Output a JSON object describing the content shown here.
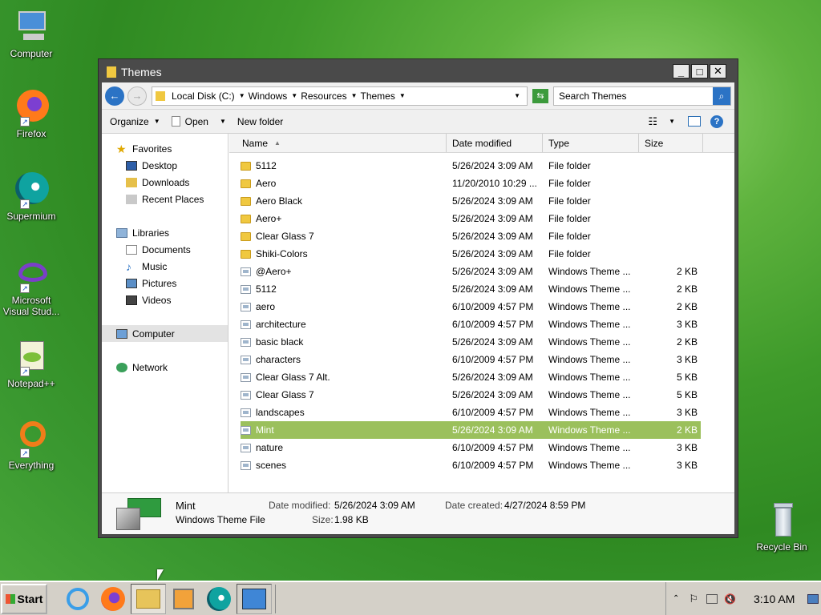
{
  "desktop": {
    "icons": [
      {
        "label": "Computer"
      },
      {
        "label": "Firefox"
      },
      {
        "label": "Supermium"
      },
      {
        "label": "Microsoft Visual Stud..."
      },
      {
        "label": "Notepad++"
      },
      {
        "label": "Everything"
      },
      {
        "label": "Recycle Bin"
      }
    ]
  },
  "window": {
    "title": "Themes",
    "controls": {
      "minimize": "_",
      "maximize": "□",
      "close": "✕"
    },
    "breadcrumb": [
      "Local Disk (C:)",
      "Windows",
      "Resources",
      "Themes"
    ],
    "search_placeholder": "Search Themes",
    "toolbar": {
      "organize": "Organize",
      "open": "Open",
      "new_folder": "New folder"
    },
    "nav": {
      "favorites": "Favorites",
      "desktop": "Desktop",
      "downloads": "Downloads",
      "recent": "Recent Places",
      "libraries": "Libraries",
      "documents": "Documents",
      "music": "Music",
      "pictures": "Pictures",
      "videos": "Videos",
      "computer": "Computer",
      "network": "Network"
    },
    "columns": {
      "name": "Name",
      "date": "Date modified",
      "type": "Type",
      "size": "Size"
    },
    "files": [
      {
        "name": "5112",
        "date": "5/26/2024 3:09 AM",
        "type": "File folder",
        "size": "",
        "kind": "folder"
      },
      {
        "name": "Aero",
        "date": "11/20/2010 10:29 ...",
        "type": "File folder",
        "size": "",
        "kind": "folder"
      },
      {
        "name": "Aero Black",
        "date": "5/26/2024 3:09 AM",
        "type": "File folder",
        "size": "",
        "kind": "folder"
      },
      {
        "name": "Aero+",
        "date": "5/26/2024 3:09 AM",
        "type": "File folder",
        "size": "",
        "kind": "folder"
      },
      {
        "name": "Clear Glass 7",
        "date": "5/26/2024 3:09 AM",
        "type": "File folder",
        "size": "",
        "kind": "folder"
      },
      {
        "name": "Shiki-Colors",
        "date": "5/26/2024 3:09 AM",
        "type": "File folder",
        "size": "",
        "kind": "folder"
      },
      {
        "name": "@Aero+",
        "date": "5/26/2024 3:09 AM",
        "type": "Windows Theme ...",
        "size": "2 KB",
        "kind": "file"
      },
      {
        "name": "5112",
        "date": "5/26/2024 3:09 AM",
        "type": "Windows Theme ...",
        "size": "2 KB",
        "kind": "file"
      },
      {
        "name": "aero",
        "date": "6/10/2009 4:57 PM",
        "type": "Windows Theme ...",
        "size": "2 KB",
        "kind": "file"
      },
      {
        "name": "architecture",
        "date": "6/10/2009 4:57 PM",
        "type": "Windows Theme ...",
        "size": "3 KB",
        "kind": "file"
      },
      {
        "name": "basic black",
        "date": "5/26/2024 3:09 AM",
        "type": "Windows Theme ...",
        "size": "2 KB",
        "kind": "file"
      },
      {
        "name": "characters",
        "date": "6/10/2009 4:57 PM",
        "type": "Windows Theme ...",
        "size": "3 KB",
        "kind": "file"
      },
      {
        "name": "Clear Glass 7 Alt.",
        "date": "5/26/2024 3:09 AM",
        "type": "Windows Theme ...",
        "size": "5 KB",
        "kind": "file"
      },
      {
        "name": "Clear Glass 7",
        "date": "5/26/2024 3:09 AM",
        "type": "Windows Theme ...",
        "size": "5 KB",
        "kind": "file"
      },
      {
        "name": "landscapes",
        "date": "6/10/2009 4:57 PM",
        "type": "Windows Theme ...",
        "size": "3 KB",
        "kind": "file"
      },
      {
        "name": "Mint",
        "date": "5/26/2024 3:09 AM",
        "type": "Windows Theme ...",
        "size": "2 KB",
        "kind": "file",
        "selected": true
      },
      {
        "name": "nature",
        "date": "6/10/2009 4:57 PM",
        "type": "Windows Theme ...",
        "size": "3 KB",
        "kind": "file"
      },
      {
        "name": "scenes",
        "date": "6/10/2009 4:57 PM",
        "type": "Windows Theme ...",
        "size": "3 KB",
        "kind": "file"
      }
    ],
    "details": {
      "name": "Mint",
      "kind": "Windows Theme File",
      "modified_label": "Date modified:",
      "modified": "5/26/2024 3:09 AM",
      "created_label": "Date created:",
      "created": "4/27/2024 8:59 PM",
      "size_label": "Size:",
      "size": "1.98 KB"
    }
  },
  "taskbar": {
    "start": "Start",
    "clock": "3:10 AM"
  },
  "colors": {
    "selection": "#9bc05c",
    "window_frame": "#4a4a4a"
  }
}
